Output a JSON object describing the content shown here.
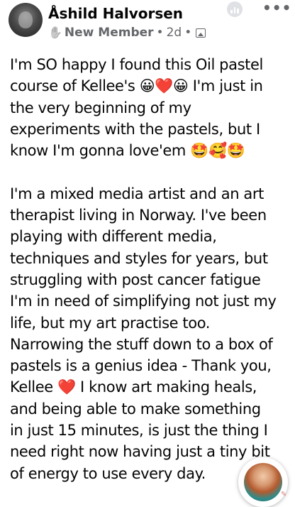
{
  "post": {
    "author": "Åshild Halvorsen",
    "role": "New Member",
    "time": "2d",
    "separator": "•",
    "body_lines": [
      "I'm SO happy I found this Oil pastel",
      "course of Kellee's 😀❤️😀 I'm just in",
      "the very beginning of my",
      "experiments with the pastels, but I",
      "know I'm gonna love'em 🤩🥰🤩",
      "",
      "I'm a mixed media artist and an art",
      "therapist living in Norway. I've been",
      "playing with different media,",
      "techniques and styles for years, but",
      "struggling with post cancer fatigue",
      "I'm in need of simplifying not just my",
      "life, but my art practise too.",
      "Narrowing the stuff down to a box of",
      "pastels is a genius idea - Thank you,",
      "Kellee ❤️ I know art making heals,",
      "and being able to make something",
      "in just 15 minutes, is just the thing I",
      "need right now having just a tiny bit",
      "of energy to use every day."
    ]
  },
  "icons": {
    "avatar": "profile-photo",
    "role_badge": "waving-hand-icon",
    "audience": "group-audience-icon",
    "insights": "insights-icon",
    "more": "more-options-icon",
    "chathead": "chat-head-avatar",
    "edit": "pencil-icon"
  },
  "colors": {
    "text": "#050505",
    "meta": "#65676b",
    "insights_bg": "#dfe1e5"
  }
}
